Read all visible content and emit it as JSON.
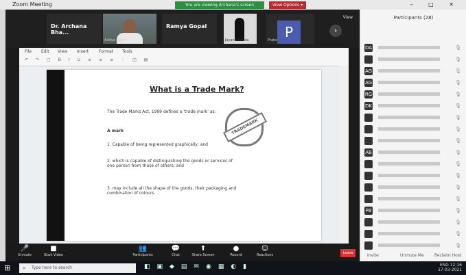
{
  "window": {
    "title": "Zoom Meeting",
    "controls": "–  □  ✕"
  },
  "share_banner": {
    "text": "You are viewing Archana's screen",
    "stop": "View Options ▾"
  },
  "participants_strip": {
    "tiles": [
      {
        "name": "Dr. Archana Bha..."
      },
      {
        "name": "",
        "sub": "Aditya Gupta"
      },
      {
        "name": "Ramya Gopal"
      },
      {
        "name": "",
        "sub": "Jayanti Kanda"
      },
      {
        "name": "",
        "sub": "Prateek Kumar"
      }
    ],
    "avatar_letter": "P",
    "view": "View"
  },
  "doc": {
    "menus": [
      "File",
      "Edit",
      "View",
      "Insert",
      "Format",
      "Tools"
    ],
    "slide_title": "What is a Trade Mark?",
    "para1": "The Trade Marks Act, 1999 defines a 'trade mark' as:",
    "heading": "A mark",
    "items": [
      "1. Capable of being represented graphically; and",
      "2. which is capable of distinguishing the goods or services of one person from those of others; and",
      "3. may include all the shape of the goods, their packaging and combination of colours"
    ],
    "stamp": "TRADEMARK"
  },
  "controls": {
    "items": [
      {
        "label": "Unmute",
        "icon": "🎤"
      },
      {
        "label": "Start Video",
        "icon": "■"
      },
      {
        "label": "Participants",
        "icon": "👥"
      },
      {
        "label": "Chat",
        "icon": "💬"
      },
      {
        "label": "Share Screen",
        "icon": "⬆"
      },
      {
        "label": "Record",
        "icon": "●"
      },
      {
        "label": "Reactions",
        "icon": "☺"
      }
    ],
    "leave": "Leave"
  },
  "panel": {
    "title": "Participants (28)",
    "rows": [
      "DA",
      "",
      "AG",
      "AG",
      "RG",
      "DK",
      "",
      "",
      "",
      "AB",
      "",
      "",
      "",
      "",
      "PB",
      "",
      "",
      ""
    ],
    "footer": [
      "Invite",
      "Unmute Me",
      "Reclaim Host"
    ]
  },
  "taskbar": {
    "search_placeholder": "Type here to search",
    "time": "12:16",
    "date": "17-03-2021",
    "lang": "ENG"
  }
}
